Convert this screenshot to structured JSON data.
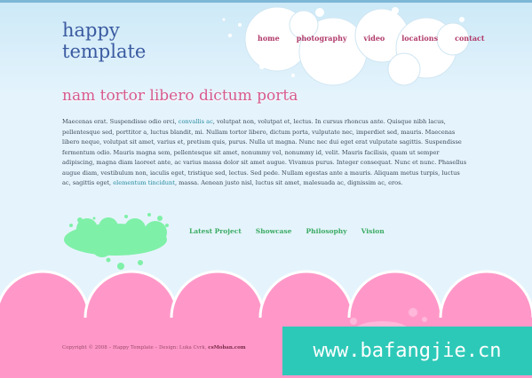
{
  "logo": {
    "line1": "happy",
    "line2": "template"
  },
  "nav": {
    "items": [
      "home",
      "photography",
      "video",
      "locations",
      "contact"
    ]
  },
  "main": {
    "title": "nam tortor libero dictum porta",
    "text_part1": "Maecenas erat. Suspendisse odio orci, ",
    "link1": "convallis ac",
    "text_part2": ", volutpat non, volutpat et, lectus. In cursus rhoncus ante. Quisque nibh lacus, pellentesque sed, porttitor a, luctus blandit, mi. Nullam tortor libero, dictum porta, vulputate nec, imperdiet sed, mauris. Maecenas libero neque, volutpat sit amet, varius et, pretium quis, purus. Nulla ut magna. Nunc nec dui eget erat vulputate sagittis. Suspendisse fermentum odio. Mauris magna sem, pellentesque sit amet, nonummy vel, nonummy id, velit. Mauris facilisis, quam ut semper adipiscing, magna diam laoreet ante, ac varius massa dolor sit amet augue. Vivamus purus. Integer consequat. Nunc et nunc. Phasellus augue diam, vestibulum non, iaculis eget, tristique sed, lectus. Sed pede. Nullam egestas ante a mauris. Aliquam metus turpis, luctus ac, sagittis eget, ",
    "link2": "elementum tincidunt",
    "text_part3": ", massa. Aenean justo nisl, luctus sit amet, malesuada ac, dignissim ac, eros."
  },
  "sub_nav": {
    "items": [
      "Latest Project",
      "Showcase",
      "Philosophy",
      "Vision"
    ]
  },
  "footer": {
    "copyright": "Copyright © 2008 – Happy Template – Design: Luka Cvrk,",
    "credit": "csMoban.com"
  },
  "watermark": "www.bafangjie.cn",
  "colors": {
    "pink": "#ff98c8",
    "green": "#7ff0a8",
    "sky": "#cde9f7"
  }
}
